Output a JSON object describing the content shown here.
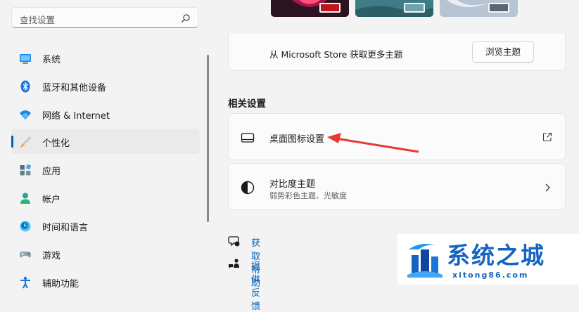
{
  "search": {
    "placeholder": "查找设置"
  },
  "sidebar": {
    "items": [
      {
        "label": "系统",
        "icon": "system-icon"
      },
      {
        "label": "蓝牙和其他设备",
        "icon": "bluetooth-icon"
      },
      {
        "label": "网络 & Internet",
        "icon": "wifi-icon"
      },
      {
        "label": "个性化",
        "icon": "brush-icon",
        "selected": true
      },
      {
        "label": "应用",
        "icon": "apps-icon"
      },
      {
        "label": "帐户",
        "icon": "account-icon"
      },
      {
        "label": "时间和语言",
        "icon": "clock-globe-icon"
      },
      {
        "label": "游戏",
        "icon": "gamepad-icon"
      },
      {
        "label": "辅助功能",
        "icon": "accessibility-icon"
      }
    ]
  },
  "themes": {
    "store_text": "从 Microsoft Store 获取更多主题",
    "browse_button": "浏览主题",
    "cards": [
      {
        "bg": "#2a1420",
        "swatch": "#c1121f"
      },
      {
        "bg": "#3f7d86",
        "swatch": "#6fa3aa"
      },
      {
        "bg": "#b7c4d3",
        "swatch": "#5a6674"
      }
    ]
  },
  "related": {
    "title": "相关设置",
    "items": [
      {
        "title": "桌面图标设置",
        "icon": "desktop-icon",
        "trail": "external-link-icon"
      },
      {
        "title": "对比度主题",
        "subtitle": "弱势彩色主题、光敏度",
        "icon": "contrast-icon",
        "trail": "chevron-right-icon"
      }
    ]
  },
  "links": {
    "help": "获取帮助",
    "feedback": "提供反馈"
  },
  "watermark": {
    "brand": "系统之城",
    "url": "xitong86.com"
  },
  "colors": {
    "accent": "#005fb8",
    "annotation_arrow": "#e53935",
    "watermark": "#1565c0"
  }
}
